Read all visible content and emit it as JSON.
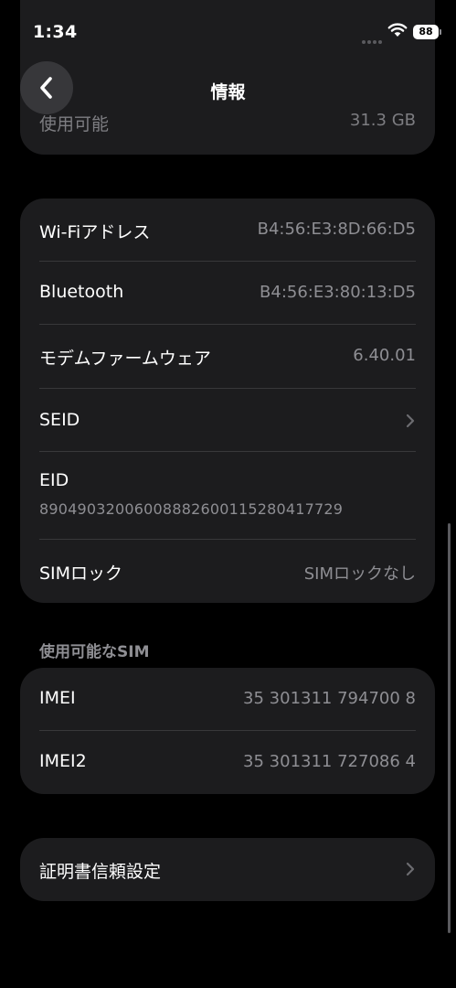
{
  "status_bar": {
    "time": "1:34",
    "battery": "88"
  },
  "nav": {
    "title": "情報"
  },
  "storage": {
    "available_label": "使用可能",
    "available_value": "31.3 GB"
  },
  "network": {
    "rows": [
      {
        "label": "Wi-Fiアドレス",
        "value": "B4:56:E3:8D:66:D5"
      },
      {
        "label": "Bluetooth",
        "value": "B4:56:E3:80:13:D5"
      },
      {
        "label": "モデムファームウェア",
        "value": "6.40.01"
      },
      {
        "label": "SEID",
        "value": ""
      },
      {
        "label": "EID",
        "value": "89049032006008882600115280417729"
      },
      {
        "label": "SIMロック",
        "value": "SIMロックなし"
      }
    ]
  },
  "sim_section": {
    "header": "使用可能なSIM",
    "rows": [
      {
        "label": "IMEI",
        "value": "35 301311 794700 8"
      },
      {
        "label": "IMEI2",
        "value": "35 301311 727086 4"
      }
    ]
  },
  "certificate": {
    "label": "証明書信頼設定"
  },
  "colors": {
    "background": "#000000",
    "card": "#1c1c1e",
    "secondary_text": "#8e8e93",
    "separator": "#38383a"
  },
  "icons": {
    "back": "chevron-left-icon",
    "disclosure": "chevron-right-icon",
    "wifi": "wifi-icon",
    "battery": "battery-icon"
  }
}
